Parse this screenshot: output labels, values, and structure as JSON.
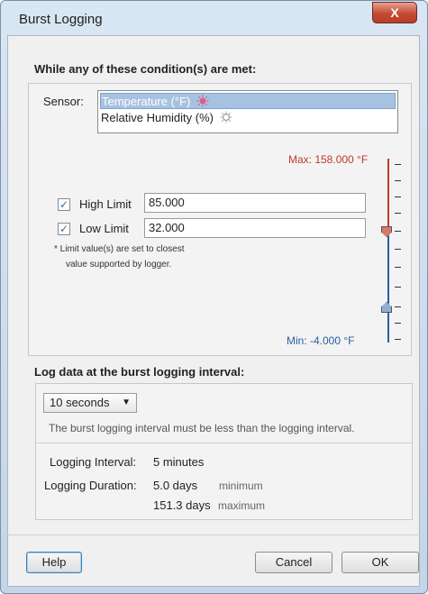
{
  "window": {
    "title": "Burst Logging",
    "close_glyph": "X"
  },
  "conditions": {
    "heading": "While any of these condition(s) are met:",
    "sensor_label": "Sensor:",
    "sensors": [
      {
        "label": "Temperature (°F)",
        "selected": true,
        "icon": "temperature-sensor-icon"
      },
      {
        "label": "Relative Humidity (%)",
        "selected": false,
        "icon": "humidity-sensor-icon"
      }
    ],
    "max_label": "Max: 158.000 °F",
    "min_label": "Min: -4.000 °F",
    "high_limit": {
      "label": "High Limit",
      "checked": true,
      "value": "85.000"
    },
    "low_limit": {
      "label": "Low Limit",
      "checked": true,
      "value": "32.000"
    },
    "note_line1": "*  Limit value(s) are set to closest",
    "note_line2": "value supported by logger."
  },
  "interval": {
    "heading": "Log data at the burst logging interval:",
    "selected": "10 seconds",
    "hint": "The burst logging interval must be less than the logging interval.",
    "logging_interval_label": "Logging Interval:",
    "logging_interval_value": "5 minutes",
    "logging_duration_label": "Logging Duration:",
    "duration_min_value": "5.0 days",
    "duration_min_note": "minimum",
    "duration_max_value": "151.3 days",
    "duration_max_note": "maximum"
  },
  "buttons": {
    "help": "Help",
    "cancel": "Cancel",
    "ok": "OK"
  },
  "colors": {
    "max": "#c0392b",
    "min": "#2a5fa0",
    "high_thumb": "#d9776b",
    "low_thumb": "#8fb0d6"
  }
}
